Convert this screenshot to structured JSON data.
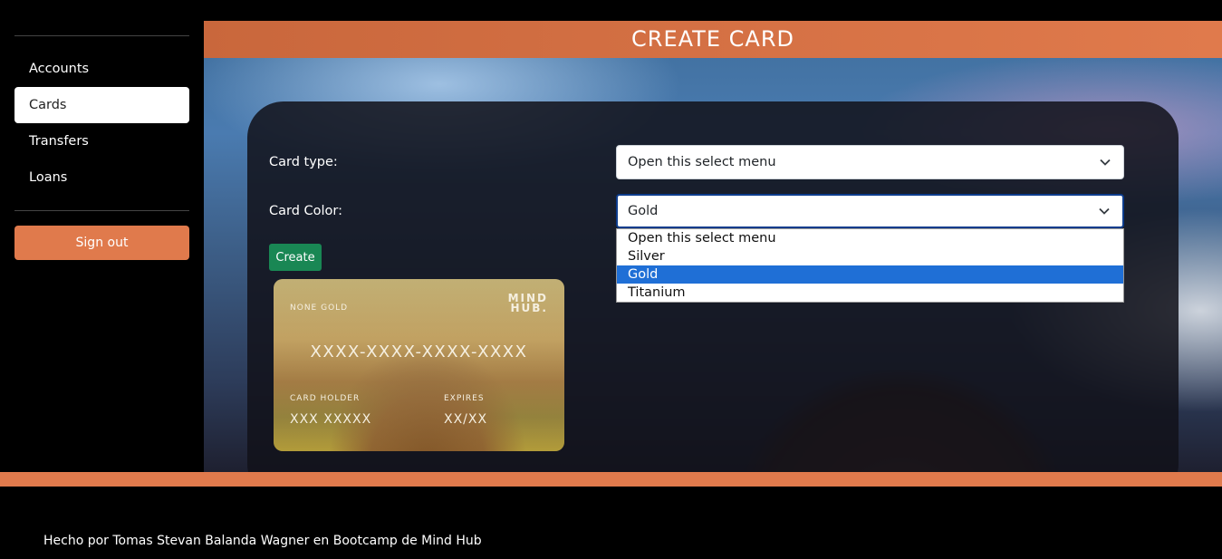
{
  "sidebar": {
    "items": [
      {
        "label": "Accounts"
      },
      {
        "label": "Cards"
      },
      {
        "label": "Transfers"
      },
      {
        "label": "Loans"
      }
    ],
    "signout_label": "Sign out"
  },
  "header": {
    "title": "CREATE CARD"
  },
  "form": {
    "card_type_label": "Card type:",
    "card_type_value": "Open this select menu",
    "card_color_label": "Card Color:",
    "card_color_value": "Gold",
    "color_options": [
      "Open this select menu",
      "Silver",
      "Gold",
      "Titanium"
    ],
    "selected_option": "Gold",
    "create_label": "Create"
  },
  "card": {
    "type": "NONE GOLD",
    "logo_line1": "MIND",
    "logo_line2": "HUB.",
    "number": "XXXX-XXXX-XXXX-XXXX",
    "holder_label": "CARD HOLDER",
    "holder": "XXX XXXXX",
    "expires_label": "EXPIRES",
    "expires": "XX/XX"
  },
  "footer": {
    "text": "Hecho por Tomas Stevan Balanda Wagner en Bootcamp de Mind Hub"
  },
  "colors": {
    "accent": "#e07a4c",
    "create_button": "#198754",
    "selected_option": "#1f6fd6"
  }
}
